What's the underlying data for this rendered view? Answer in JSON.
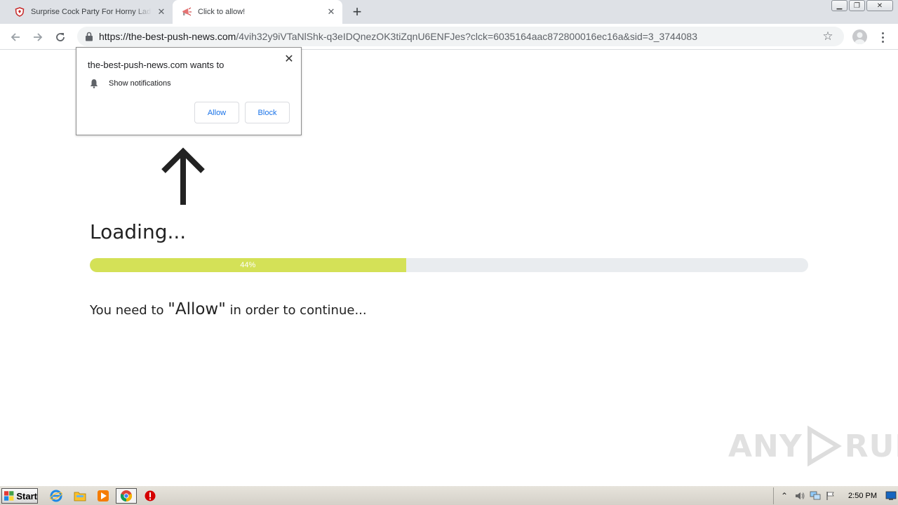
{
  "browser": {
    "tabs": [
      {
        "title": "Surprise Cock Party For Horny Ladies",
        "active": false
      },
      {
        "title": "Click to allow!",
        "active": true
      }
    ],
    "url_host": "https://the-best-push-news.com",
    "url_path": "/4vih32y9iVTaNlShk-q3eIDQnezOK3tiZqnU6ENFJes?clck=6035164aac872800016ec16a&sid=3_3744083"
  },
  "permission_popup": {
    "title": "the-best-push-news.com wants to",
    "permission": "Show notifications",
    "allow_label": "Allow",
    "block_label": "Block"
  },
  "page": {
    "heading": "Loading...",
    "progress_label": "44%",
    "progress_value": 0.44,
    "notice_before": "You need to ",
    "notice_emphasis": "\"Allow\"",
    "notice_after": " in order to continue..."
  },
  "watermark": {
    "left": "ANY",
    "right": "RUN"
  },
  "taskbar": {
    "start_label": "Start",
    "clock": "2:50 PM"
  },
  "colors": {
    "progress_fill": "#d4e157",
    "progress_track": "#e9ecef",
    "link_blue": "#1a73e8"
  }
}
